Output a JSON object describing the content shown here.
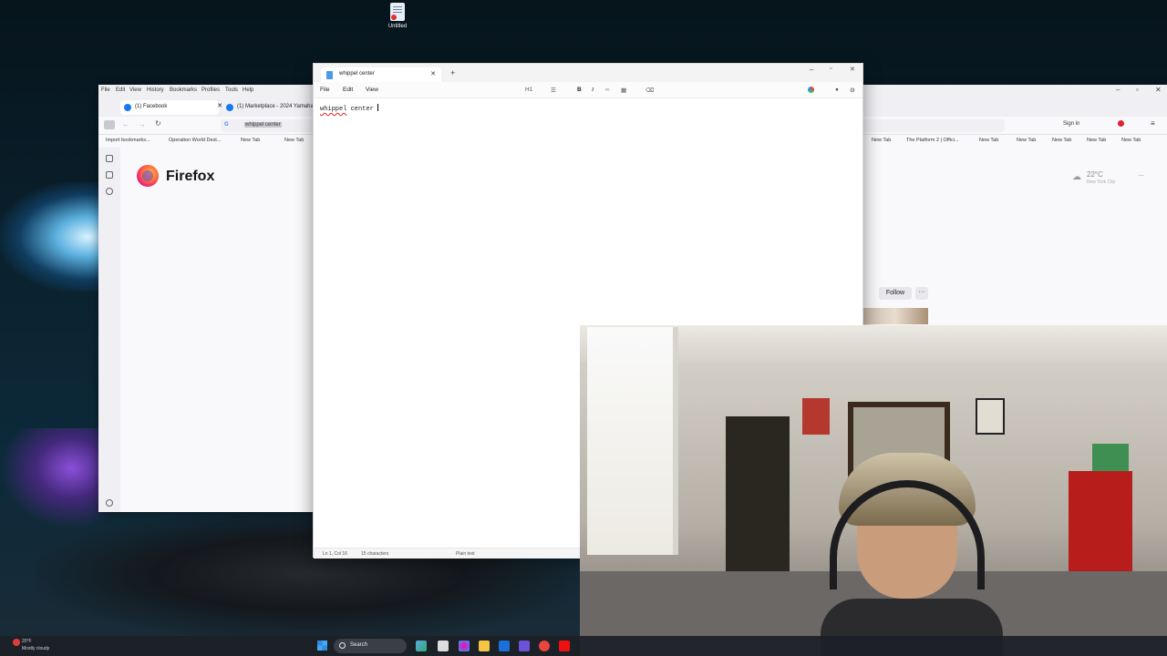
{
  "desktop": {
    "icon_label": "Untitled"
  },
  "firefox": {
    "menu": [
      "File",
      "Edit",
      "View",
      "History",
      "Bookmarks",
      "Profiles",
      "Tools",
      "Help"
    ],
    "tabs": [
      {
        "label": "(1) Facebook"
      },
      {
        "label": "(1) Marketplace - 2024 Yamaha"
      }
    ],
    "url_selected_text": "whippel center",
    "bookmarks": [
      "Import bookmarks...",
      "Operation World Dest...",
      "New Tab",
      "New Tab",
      "New Tab",
      "The Platform 2 | Offici...",
      "New Tab",
      "New Tab",
      "New Tab",
      "New Tab",
      "New Tab"
    ],
    "sign_in": "Sign in",
    "logo_text": "Firefox",
    "weather": {
      "temp": "22°C",
      "city": "New York City"
    },
    "follow_label": "Follow",
    "more_label": "···"
  },
  "notepad": {
    "tab_title": "whippel center",
    "menu": [
      "File",
      "Edit",
      "View"
    ],
    "toolbar": {
      "heading": "H1",
      "bold": "B",
      "italic": "I"
    },
    "content_word1": "whippel",
    "content_rest": " center ",
    "status": {
      "position": "Ln 1, Col 16",
      "chars": "15 characters",
      "format": "Plain text"
    }
  },
  "taskbar": {
    "weather_temp": "20°F",
    "weather_desc": "Mostly cloudy",
    "search_label": "Search"
  },
  "colors": {
    "firefox_orange": "#ff7139",
    "facebook_blue": "#1877f2",
    "notepad_accent": "#4a9be8",
    "misspell_red": "#d22"
  }
}
